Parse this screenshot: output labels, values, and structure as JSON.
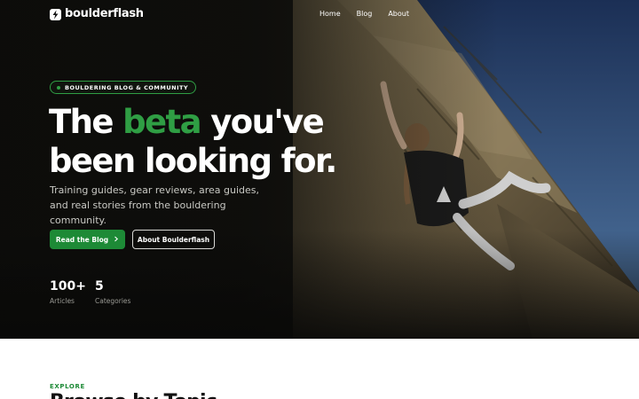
{
  "brand": {
    "name": "boulderflash"
  },
  "nav": {
    "links": [
      {
        "label": "Home"
      },
      {
        "label": "Blog"
      },
      {
        "label": "About"
      }
    ]
  },
  "hero": {
    "badge": "BOULDERING BLOG & COMMUNITY",
    "headline": {
      "pre": "The ",
      "accent": "beta",
      "post": " you've been looking for."
    },
    "subtitle": "Training guides, gear reviews, area guides, and real stories from the bouldering community.",
    "cta_primary": "Read the Blog",
    "cta_secondary": "About Boulderflash",
    "stats": [
      {
        "value": "100+",
        "label": "Articles"
      },
      {
        "value": "5",
        "label": "Categories"
      }
    ]
  },
  "explore": {
    "label": "EXPLORE",
    "title": "Browse by Topic"
  },
  "colors": {
    "accent": "#2f9e44",
    "button": "#1d8a36",
    "hero_bg": "#15130f"
  }
}
